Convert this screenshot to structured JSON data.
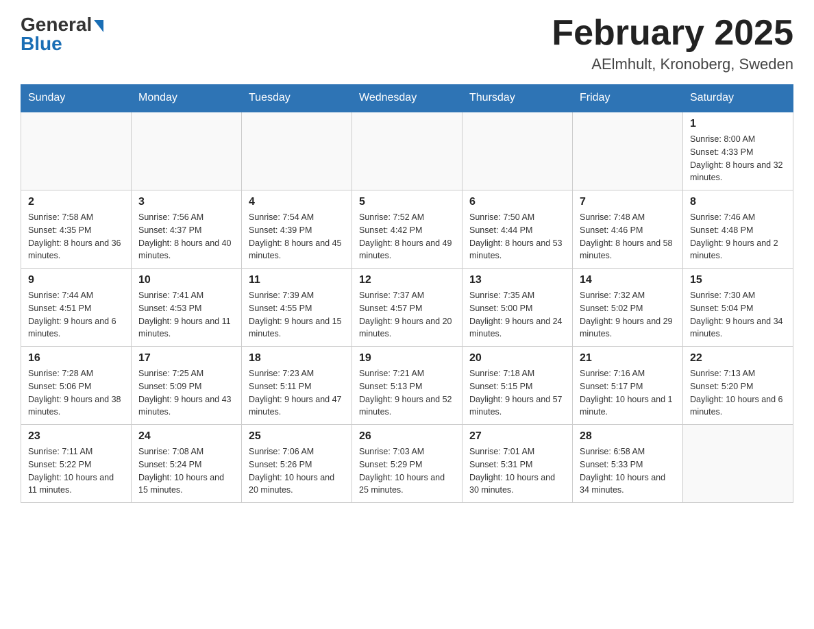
{
  "logo": {
    "general": "General",
    "blue": "Blue"
  },
  "header": {
    "month_year": "February 2025",
    "location": "AElmhult, Kronoberg, Sweden"
  },
  "weekdays": [
    "Sunday",
    "Monday",
    "Tuesday",
    "Wednesday",
    "Thursday",
    "Friday",
    "Saturday"
  ],
  "weeks": [
    [
      {
        "day": "",
        "info": ""
      },
      {
        "day": "",
        "info": ""
      },
      {
        "day": "",
        "info": ""
      },
      {
        "day": "",
        "info": ""
      },
      {
        "day": "",
        "info": ""
      },
      {
        "day": "",
        "info": ""
      },
      {
        "day": "1",
        "info": "Sunrise: 8:00 AM\nSunset: 4:33 PM\nDaylight: 8 hours and 32 minutes."
      }
    ],
    [
      {
        "day": "2",
        "info": "Sunrise: 7:58 AM\nSunset: 4:35 PM\nDaylight: 8 hours and 36 minutes."
      },
      {
        "day": "3",
        "info": "Sunrise: 7:56 AM\nSunset: 4:37 PM\nDaylight: 8 hours and 40 minutes."
      },
      {
        "day": "4",
        "info": "Sunrise: 7:54 AM\nSunset: 4:39 PM\nDaylight: 8 hours and 45 minutes."
      },
      {
        "day": "5",
        "info": "Sunrise: 7:52 AM\nSunset: 4:42 PM\nDaylight: 8 hours and 49 minutes."
      },
      {
        "day": "6",
        "info": "Sunrise: 7:50 AM\nSunset: 4:44 PM\nDaylight: 8 hours and 53 minutes."
      },
      {
        "day": "7",
        "info": "Sunrise: 7:48 AM\nSunset: 4:46 PM\nDaylight: 8 hours and 58 minutes."
      },
      {
        "day": "8",
        "info": "Sunrise: 7:46 AM\nSunset: 4:48 PM\nDaylight: 9 hours and 2 minutes."
      }
    ],
    [
      {
        "day": "9",
        "info": "Sunrise: 7:44 AM\nSunset: 4:51 PM\nDaylight: 9 hours and 6 minutes."
      },
      {
        "day": "10",
        "info": "Sunrise: 7:41 AM\nSunset: 4:53 PM\nDaylight: 9 hours and 11 minutes."
      },
      {
        "day": "11",
        "info": "Sunrise: 7:39 AM\nSunset: 4:55 PM\nDaylight: 9 hours and 15 minutes."
      },
      {
        "day": "12",
        "info": "Sunrise: 7:37 AM\nSunset: 4:57 PM\nDaylight: 9 hours and 20 minutes."
      },
      {
        "day": "13",
        "info": "Sunrise: 7:35 AM\nSunset: 5:00 PM\nDaylight: 9 hours and 24 minutes."
      },
      {
        "day": "14",
        "info": "Sunrise: 7:32 AM\nSunset: 5:02 PM\nDaylight: 9 hours and 29 minutes."
      },
      {
        "day": "15",
        "info": "Sunrise: 7:30 AM\nSunset: 5:04 PM\nDaylight: 9 hours and 34 minutes."
      }
    ],
    [
      {
        "day": "16",
        "info": "Sunrise: 7:28 AM\nSunset: 5:06 PM\nDaylight: 9 hours and 38 minutes."
      },
      {
        "day": "17",
        "info": "Sunrise: 7:25 AM\nSunset: 5:09 PM\nDaylight: 9 hours and 43 minutes."
      },
      {
        "day": "18",
        "info": "Sunrise: 7:23 AM\nSunset: 5:11 PM\nDaylight: 9 hours and 47 minutes."
      },
      {
        "day": "19",
        "info": "Sunrise: 7:21 AM\nSunset: 5:13 PM\nDaylight: 9 hours and 52 minutes."
      },
      {
        "day": "20",
        "info": "Sunrise: 7:18 AM\nSunset: 5:15 PM\nDaylight: 9 hours and 57 minutes."
      },
      {
        "day": "21",
        "info": "Sunrise: 7:16 AM\nSunset: 5:17 PM\nDaylight: 10 hours and 1 minute."
      },
      {
        "day": "22",
        "info": "Sunrise: 7:13 AM\nSunset: 5:20 PM\nDaylight: 10 hours and 6 minutes."
      }
    ],
    [
      {
        "day": "23",
        "info": "Sunrise: 7:11 AM\nSunset: 5:22 PM\nDaylight: 10 hours and 11 minutes."
      },
      {
        "day": "24",
        "info": "Sunrise: 7:08 AM\nSunset: 5:24 PM\nDaylight: 10 hours and 15 minutes."
      },
      {
        "day": "25",
        "info": "Sunrise: 7:06 AM\nSunset: 5:26 PM\nDaylight: 10 hours and 20 minutes."
      },
      {
        "day": "26",
        "info": "Sunrise: 7:03 AM\nSunset: 5:29 PM\nDaylight: 10 hours and 25 minutes."
      },
      {
        "day": "27",
        "info": "Sunrise: 7:01 AM\nSunset: 5:31 PM\nDaylight: 10 hours and 30 minutes."
      },
      {
        "day": "28",
        "info": "Sunrise: 6:58 AM\nSunset: 5:33 PM\nDaylight: 10 hours and 34 minutes."
      },
      {
        "day": "",
        "info": ""
      }
    ]
  ]
}
